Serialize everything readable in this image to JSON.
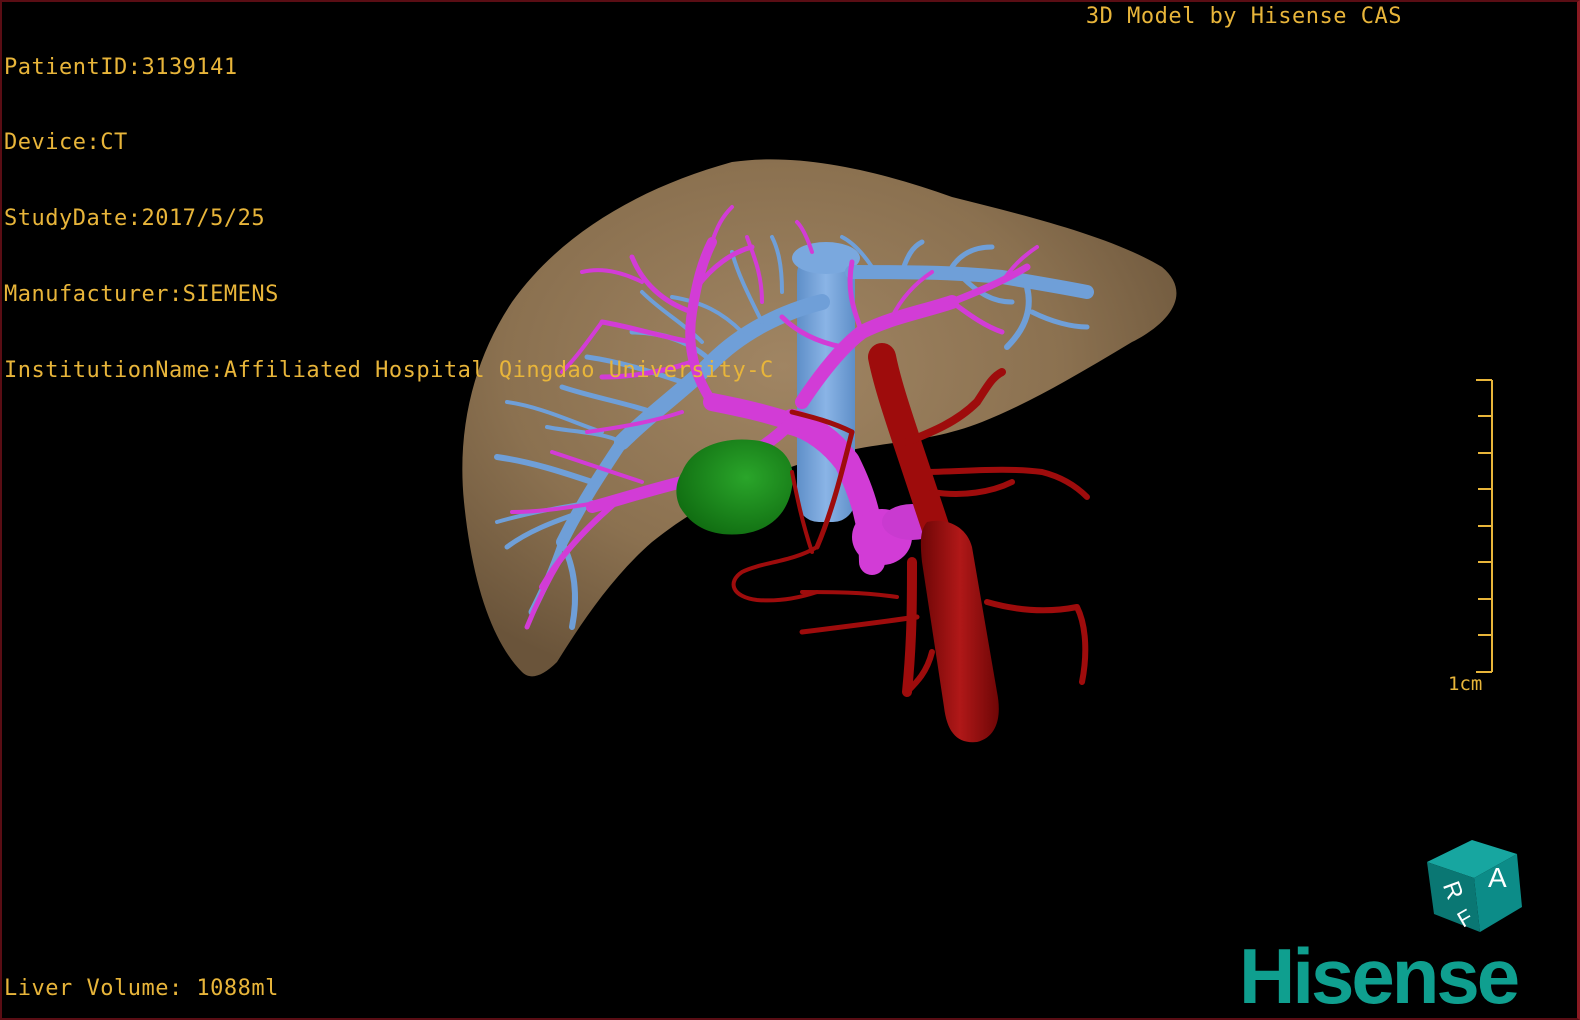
{
  "header": {
    "patient_id": "PatientID:3139141",
    "device": "Device:CT",
    "study_date": "StudyDate:2017/5/25",
    "manufacturer": "Manufacturer:SIEMENS",
    "institution": "InstitutionName:Affiliated Hospital Qingdao University-C",
    "credit": "3D Model by Hisense CAS"
  },
  "footer": {
    "liver_volume": "Liver Volume: 1088ml"
  },
  "scale_bar": {
    "label": "1cm"
  },
  "orientation_cube": {
    "faces": [
      "A",
      "R",
      "F"
    ]
  },
  "logo": {
    "text": "Hisense"
  },
  "colors": {
    "overlay_text": "#e8b53a",
    "liver": "#8b7150",
    "portal_vein": "#6f9fd8",
    "hepatic_vein": "#d23cd6",
    "artery": "#9e0c0c",
    "gallbladder": "#1f8a1f",
    "logo": "#0f9f8f",
    "cube": "#0c8c88"
  }
}
